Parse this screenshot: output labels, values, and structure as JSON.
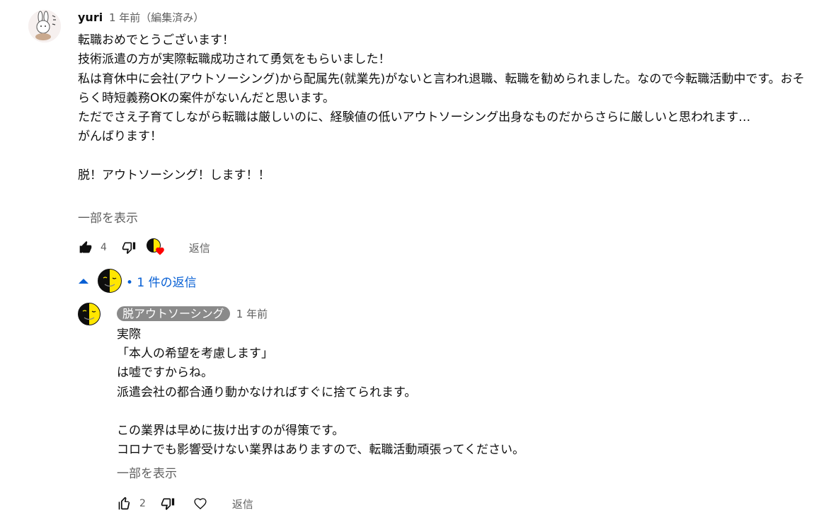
{
  "comment": {
    "author": "yuri",
    "time": "1 年前",
    "edited": "（編集済み）",
    "body": "転職おめでとうございます！\n技術派遣の方が実際転職成功されて勇気をもらいました！\n私は育休中に会社(アウトソーシング)から配属先(就業先)がないと言われ退職、転職を勧められました。なので今転職活動中です。おそらく時短義務OKの案件がないんだと思います。\nただでさえ子育てしながら転職は厳しいのに、経験値の低いアウトソーシング出身なものだからさらに厳しいと思われます…\nがんばります！\n\n脱！アウトソーシング！します！！",
    "show_more": "一部を表示",
    "likes": "4",
    "reply_label": "返信"
  },
  "replies_toggle": {
    "text": "• 1 件の返信"
  },
  "reply": {
    "author": "脱アウトソーシング",
    "time": "1 年前",
    "body": "実際\n「本人の希望を考慮します」\nは嘘ですからね。\n派遣会社の都合通り動かなければすぐに捨てられます。\n\nこの業界は早めに抜け出すのが得策です。\nコロナでも影響受けない業界はありますので、転職活動頑張ってください。",
    "show_more": "一部を表示",
    "likes": "2",
    "reply_label": "返信"
  },
  "icons": {
    "like_filled": "thumb-up-filled-icon",
    "dislike": "thumb-down-outline-icon",
    "hearted_by_creator": "creator-heart-icon",
    "collapse": "caret-up-icon",
    "like_outline": "thumb-up-outline-icon",
    "heart": "heart-outline-icon"
  },
  "colors": {
    "link_blue": "#065fd4",
    "secondary_text": "#606060",
    "heart_red": "#ff0000",
    "chip_gray": "#8a8a8a",
    "face_yellow": "#ffe600"
  }
}
